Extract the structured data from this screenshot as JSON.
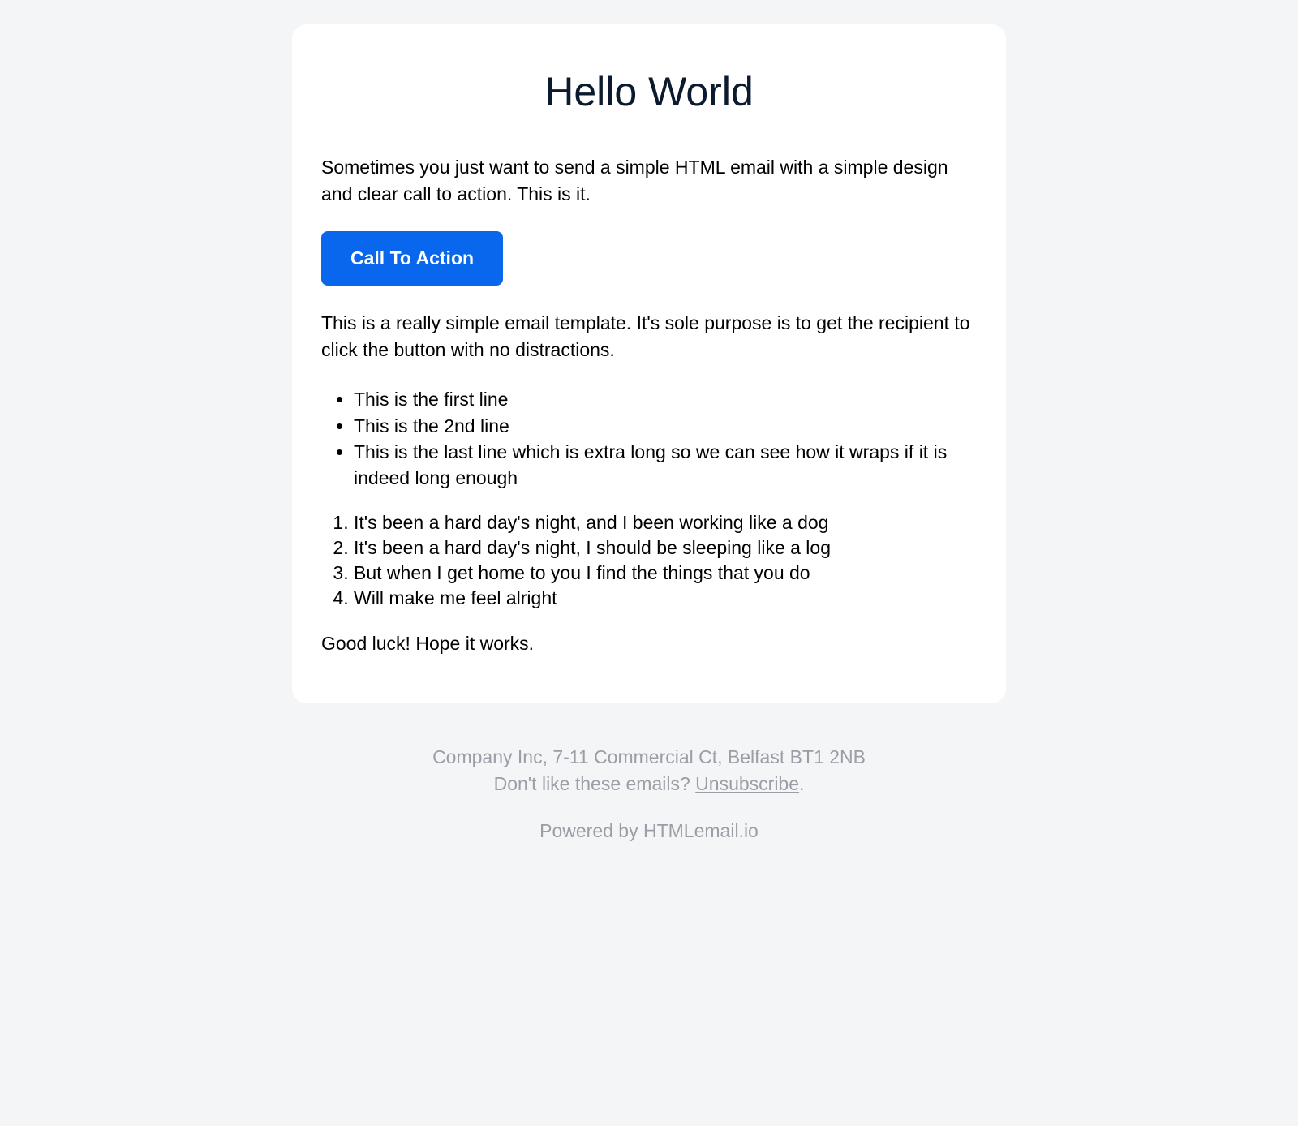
{
  "email": {
    "title": "Hello World",
    "intro": "Sometimes you just want to send a simple HTML email with a simple design and clear call to action. This is it.",
    "cta_label": "Call To Action",
    "description": "This is a really simple email template. It's sole purpose is to get the recipient to click the button with no distractions.",
    "bullets": [
      "This is the first line",
      "This is the 2nd line",
      "This is the last line which is extra long so we can see how it wraps if it is indeed long enough"
    ],
    "numbered": [
      "It's been a hard day's night, and I been working like a dog",
      "It's been a hard day's night, I should be sleeping like a log",
      "But when I get home to you I find the things that you do",
      "Will make me feel alright"
    ],
    "closing": "Good luck! Hope it works."
  },
  "footer": {
    "address": "Company Inc, 7-11 Commercial Ct, Belfast BT1 2NB",
    "unsubscribe_prompt": "Don't like these emails? ",
    "unsubscribe_link": "Unsubscribe",
    "unsubscribe_suffix": ".",
    "powered_by": "Powered by HTMLemail.io"
  }
}
